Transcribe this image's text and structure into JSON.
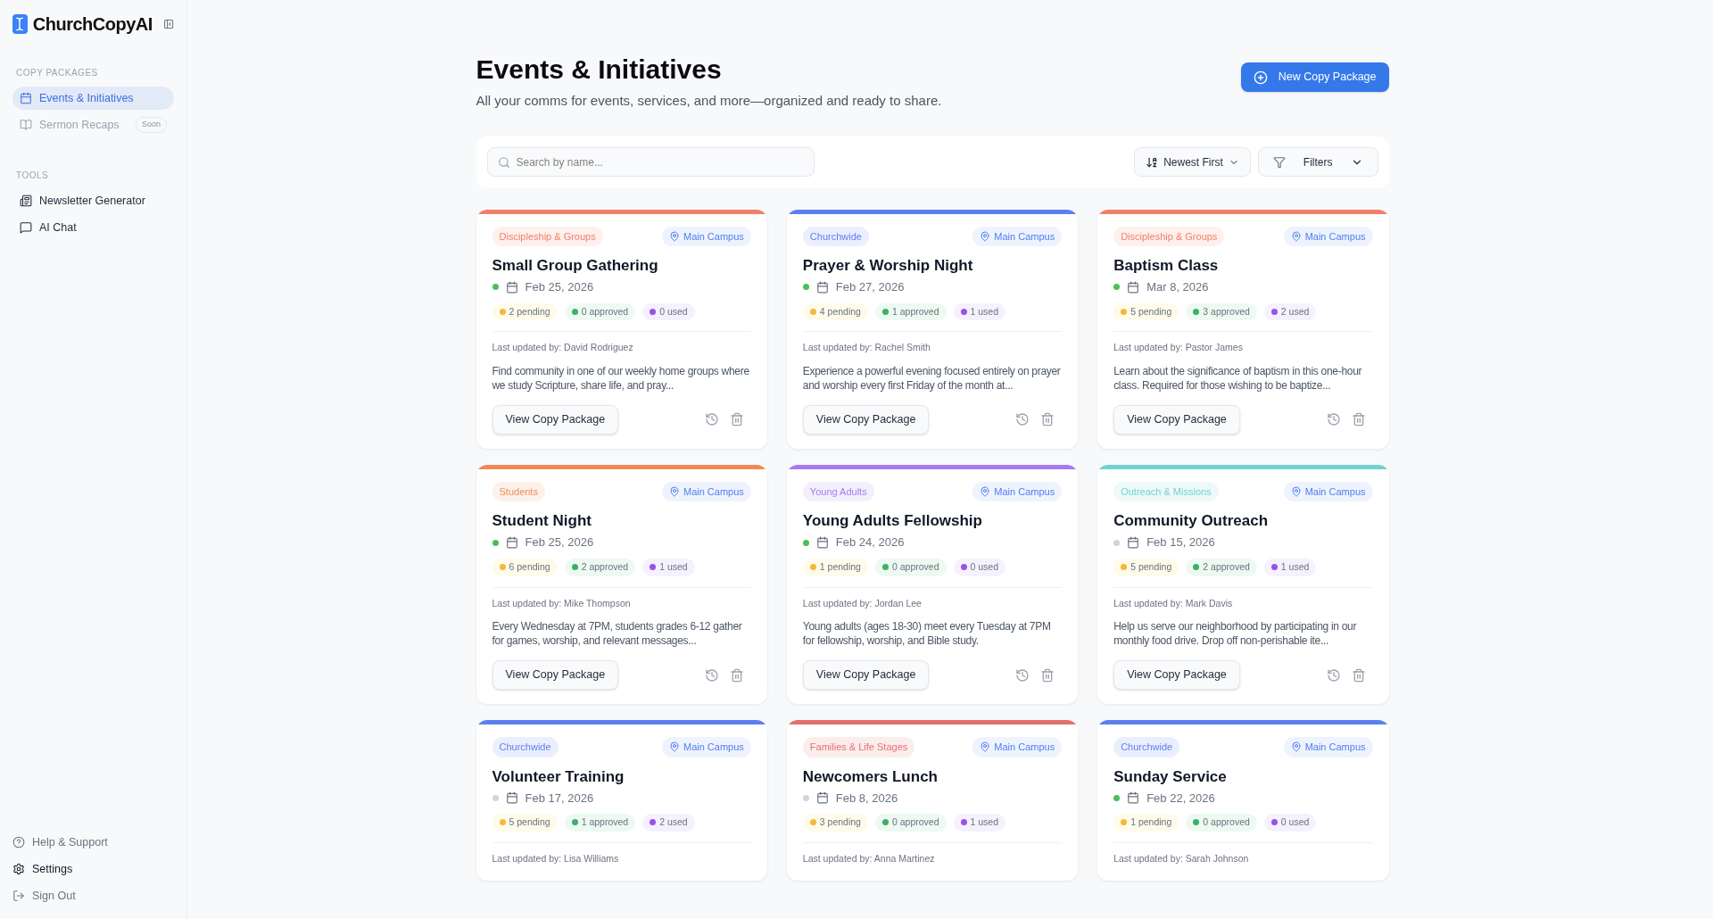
{
  "brand": {
    "name": "ChurchCopyAI"
  },
  "sidebar": {
    "sections": [
      {
        "heading": "COPY PACKAGES",
        "items": [
          {
            "label": "Events & Initiatives",
            "selected": true,
            "disabled": false
          },
          {
            "label": "Sermon Recaps",
            "selected": false,
            "disabled": true,
            "badge": "Soon"
          }
        ]
      },
      {
        "heading": "TOOLS",
        "items": [
          {
            "label": "Newsletter Generator",
            "selected": false,
            "disabled": false
          },
          {
            "label": "AI Chat",
            "selected": false,
            "disabled": false
          }
        ]
      }
    ],
    "footer": [
      {
        "label": "Help & Support",
        "muted": true
      },
      {
        "label": "Settings",
        "muted": false
      },
      {
        "label": "Sign Out",
        "muted": true
      }
    ]
  },
  "page": {
    "title": "Events & Initiatives",
    "subtitle": "All your comms for events, services, and more—organized and ready to share.",
    "primary_button": "New Copy Package"
  },
  "toolbar": {
    "search": {
      "placeholder": "Search by name..."
    },
    "sort": "Newest First",
    "filters": "Filters"
  },
  "cards": [
    {
      "category": "Discipleship & Groups",
      "color": "#f0806a",
      "location": "Main Campus",
      "title": "Small Group Gathering",
      "active": true,
      "date": "Feb 25, 2026",
      "pending": "2 pending",
      "approved": "0 approved",
      "used": "0 used",
      "updated": "Last updated by: David Rodriguez",
      "description": "Find community in one of our weekly home groups where we study Scripture, share life, and pray...",
      "button": "View Copy Package"
    },
    {
      "category": "Churchwide",
      "color": "#5b7ff0",
      "location": "Main Campus",
      "title": "Prayer & Worship Night",
      "active": true,
      "date": "Feb 27, 2026",
      "pending": "4 pending",
      "approved": "1 approved",
      "used": "1 used",
      "updated": "Last updated by: Rachel Smith",
      "description": "Experience a powerful evening focused entirely on prayer and worship every first Friday of the month at...",
      "button": "View Copy Package"
    },
    {
      "category": "Discipleship & Groups",
      "color": "#f0806a",
      "location": "Main Campus",
      "title": "Baptism Class",
      "active": true,
      "date": "Mar 8, 2026",
      "pending": "5 pending",
      "approved": "3 approved",
      "used": "2 used",
      "updated": "Last updated by: Pastor James",
      "description": "Learn about the significance of baptism in this one-hour class. Required for those wishing to be baptize...",
      "button": "View Copy Package"
    },
    {
      "category": "Students",
      "color": "#f08a55",
      "location": "Main Campus",
      "title": "Student Night",
      "active": true,
      "date": "Feb 25, 2026",
      "pending": "6 pending",
      "approved": "2 approved",
      "used": "1 used",
      "updated": "Last updated by: Mike Thompson",
      "description": "Every Wednesday at 7PM, students grades 6-12 gather for games, worship, and relevant messages...",
      "button": "View Copy Package"
    },
    {
      "category": "Young Adults",
      "color": "#a57cf0",
      "location": "Main Campus",
      "title": "Young Adults Fellowship",
      "active": true,
      "date": "Feb 24, 2026",
      "pending": "1 pending",
      "approved": "0 approved",
      "used": "0 used",
      "updated": "Last updated by: Jordan Lee",
      "description": "Young adults (ages 18-30) meet every Tuesday at 7PM for fellowship, worship, and Bible study.",
      "button": "View Copy Package"
    },
    {
      "category": "Outreach & Missions",
      "color": "#6fd3cf",
      "location": "Main Campus",
      "title": "Community Outreach",
      "active": false,
      "date": "Feb 15, 2026",
      "pending": "5 pending",
      "approved": "2 approved",
      "used": "1 used",
      "updated": "Last updated by: Mark Davis",
      "description": "Help us serve our neighborhood by participating in our monthly food drive. Drop off non-perishable ite...",
      "button": "View Copy Package"
    },
    {
      "category": "Churchwide",
      "color": "#5b7ff0",
      "location": "Main Campus",
      "title": "Volunteer Training",
      "active": false,
      "date": "Feb 17, 2026",
      "pending": "5 pending",
      "approved": "1 approved",
      "used": "2 used",
      "updated": "Last updated by: Lisa Williams"
    },
    {
      "category": "Families & Life Stages",
      "color": "#e46f6f",
      "location": "Main Campus",
      "title": "Newcomers Lunch",
      "active": false,
      "date": "Feb 8, 2026",
      "pending": "3 pending",
      "approved": "0 approved",
      "used": "1 used",
      "updated": "Last updated by: Anna Martinez"
    },
    {
      "category": "Churchwide",
      "color": "#5b7ff0",
      "location": "Main Campus",
      "title": "Sunday Service",
      "active": true,
      "date": "Feb 22, 2026",
      "pending": "1 pending",
      "approved": "0 approved",
      "used": "0 used",
      "updated": "Last updated by: Sarah Johnson"
    }
  ]
}
